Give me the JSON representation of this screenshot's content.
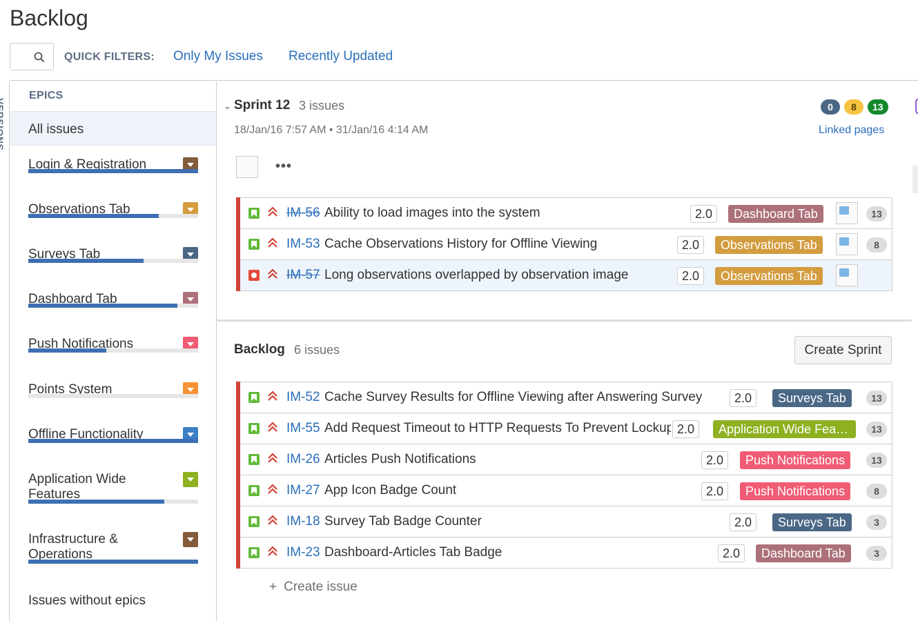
{
  "page": {
    "title": "Backlog"
  },
  "toolbar": {
    "search_placeholder": "",
    "quick_filters_label": "QUICK FILTERS:",
    "filters": [
      "Only My Issues",
      "Recently Updated"
    ]
  },
  "versions_tab": {
    "label": "VERSIONS"
  },
  "epics_panel": {
    "header": "EPICS",
    "all_issues": "All issues",
    "items": [
      {
        "name": "Login & Registration",
        "color": "#815b3a",
        "progress": 1.0
      },
      {
        "name": "Observations Tab",
        "color": "#d39c3f",
        "progress": 0.77
      },
      {
        "name": "Surveys Tab",
        "color": "#4a6785",
        "progress": 0.68
      },
      {
        "name": "Dashboard Tab",
        "color": "#ac707a",
        "progress": 0.88
      },
      {
        "name": "Push Notifications",
        "color": "#f15c75",
        "progress": 0.46
      },
      {
        "name": "Points System",
        "color": "#f79232",
        "progress": 0.0
      },
      {
        "name": "Offline Functionality",
        "color": "#3b7fc4",
        "progress": 1.0
      },
      {
        "name": "Application Wide Features",
        "color": "#8eb021",
        "progress": 0.8
      },
      {
        "name": "Infrastructure & Operations",
        "color": "#815b3a",
        "progress": 1.0
      }
    ],
    "issues_without_epics": "Issues without epics"
  },
  "sprint": {
    "name": "Sprint 12",
    "count_text": "3 issues",
    "dates": "18/Jan/16 7:57 AM • 31/Jan/16 4:14 AM",
    "status_counts": [
      {
        "value": "0",
        "color": "#4a6785",
        "text_color": "#ffffff"
      },
      {
        "value": "8",
        "color": "#f6c342",
        "text_color": "#594300"
      },
      {
        "value": "13",
        "color": "#14892c",
        "text_color": "#ffffff"
      }
    ],
    "linked_pages": "Linked pages",
    "more_label": "•••",
    "issues": [
      {
        "key": "IM-56",
        "done": true,
        "type": "story",
        "summary": "Ability to load images into the system",
        "estimate": "2.0",
        "epic": "Dashboard Tab",
        "epic_color": "#ac707a",
        "count": "13",
        "selected": false
      },
      {
        "key": "IM-53",
        "done": false,
        "type": "story",
        "summary": "Cache Observations History for Offline Viewing",
        "estimate": "2.0",
        "epic": "Observations Tab",
        "epic_color": "#d39c3f",
        "count": "8",
        "selected": false
      },
      {
        "key": "IM-57",
        "done": true,
        "type": "bug",
        "summary": "Long observations overlapped by observation image",
        "estimate": "2.0",
        "epic": "Observations Tab",
        "epic_color": "#d39c3f",
        "count": "",
        "selected": true
      }
    ]
  },
  "backlog": {
    "name": "Backlog",
    "count_text": "6 issues",
    "create_sprint_label": "Create Sprint",
    "create_issue_label": "Create issue",
    "issues": [
      {
        "key": "IM-52",
        "done": false,
        "type": "story",
        "summary": "Cache Survey Results for Offline Viewing after Answering Survey",
        "estimate": "2.0",
        "epic": "Surveys Tab",
        "epic_color": "#4a6785",
        "count": "13"
      },
      {
        "key": "IM-55",
        "done": false,
        "type": "story",
        "summary": "Add Request Timeout to HTTP Requests To Prevent Lockup",
        "estimate": "2.0",
        "epic": "Application Wide Features",
        "epic_color": "#8eb021",
        "count": "13"
      },
      {
        "key": "IM-26",
        "done": false,
        "type": "story",
        "summary": "Articles Push Notifications",
        "estimate": "2.0",
        "epic": "Push Notifications",
        "epic_color": "#f15c75",
        "count": "13"
      },
      {
        "key": "IM-27",
        "done": false,
        "type": "story",
        "summary": "App Icon Badge Count",
        "estimate": "2.0",
        "epic": "Push Notifications",
        "epic_color": "#f15c75",
        "count": "8"
      },
      {
        "key": "IM-18",
        "done": false,
        "type": "story",
        "summary": "Survey Tab Badge Counter",
        "estimate": "2.0",
        "epic": "Surveys Tab",
        "epic_color": "#4a6785",
        "count": "3"
      },
      {
        "key": "IM-23",
        "done": false,
        "type": "story",
        "summary": "Dashboard-Articles Tab Badge",
        "estimate": "2.0",
        "epic": "Dashboard Tab",
        "epic_color": "#ac707a",
        "count": "3"
      }
    ]
  }
}
